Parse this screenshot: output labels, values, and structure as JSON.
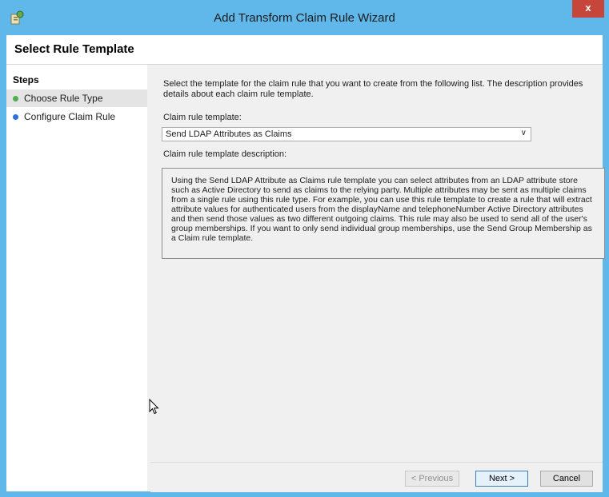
{
  "window": {
    "title": "Add Transform Claim Rule Wizard",
    "close_label": "x",
    "app_icon": "wizard-icon",
    "accent_color": "#5fb7ea"
  },
  "header": {
    "title": "Select Rule Template"
  },
  "steps": {
    "title": "Steps",
    "items": [
      {
        "label": "Choose Rule Type",
        "status_color": "#4caf50"
      },
      {
        "label": "Configure Claim Rule",
        "status_color": "#2f6fd6"
      }
    ]
  },
  "main": {
    "intro": "Select the template for the claim rule that you want to create from the following list. The description provides details about each claim rule template.",
    "template_label": "Claim rule template:",
    "template_value": "Send LDAP Attributes as Claims",
    "description_label": "Claim rule template description:",
    "description": "Using the Send LDAP Attribute as Claims rule template you can select attributes from an LDAP attribute store such as Active Directory to send as claims to the relying party. Multiple attributes may be sent as multiple claims from a single rule using this rule type. For example, you can use this rule template to create a rule that will extract attribute values for authenticated users from the displayName and telephoneNumber Active Directory attributes and then send those values as two different outgoing claims. This rule may also be used to send all of the user's group memberships. If you want to only send individual group memberships, use the Send Group Membership as a Claim rule template."
  },
  "buttons": {
    "previous": "< Previous",
    "next": "Next >",
    "cancel": "Cancel"
  }
}
